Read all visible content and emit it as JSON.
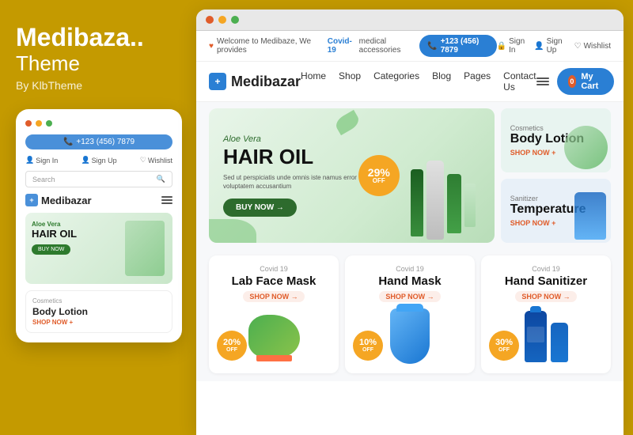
{
  "left": {
    "title": "Medibaza..",
    "subtitle": "Theme",
    "by": "By KlbTheme"
  },
  "mobile": {
    "phone": "+123 (456) 7879",
    "signin": "Sign In",
    "signup": "Sign Up",
    "wishlist": "Wishlist",
    "search_placeholder": "Search",
    "logo": "Medibazar",
    "banner_sub": "Aloe Vera",
    "banner_title": "HAIR OIL",
    "banner_btn": "BUY NOW",
    "product_cat": "Cosmetics",
    "product_name": "Body Lotion",
    "product_shop": "SHOP NOW +"
  },
  "topbar": {
    "welcome": "Welcome to Medibaze, We provides",
    "covid_link": "Covid-19",
    "covid_suffix": "medical accessories",
    "phone": "+123 (456) 7879",
    "signin": "Sign In",
    "signup": "Sign Up",
    "wishlist": "Wishlist"
  },
  "nav": {
    "logo": "Medibazar",
    "links": [
      "Home",
      "Shop",
      "Categories",
      "Blog",
      "Pages",
      "Contact Us"
    ],
    "cart_label": "My Cart",
    "cart_count": "0"
  },
  "hero": {
    "subtitle": "Aloe Vera",
    "title": "HAIR OIL",
    "description": "Sed ut perspiciatis unde omnis iste namus error sit voluptatem accusantium",
    "btn": "BUY NOW →",
    "badge_pct": "29%",
    "badge_off": "OFF"
  },
  "side_cards": [
    {
      "category": "Cosmetics",
      "name": "Body Lotion",
      "shop": "SHOP NOW +"
    },
    {
      "category": "Sanitizer",
      "name": "Temperature",
      "shop": "SHOP NOW +"
    }
  ],
  "products": [
    {
      "covid": "Covid 19",
      "name": "Lab Face Mask",
      "shop": "SHOP NOW →",
      "badge_pct": "20%",
      "badge_off": "OFF"
    },
    {
      "covid": "Covid 19",
      "name": "Hand Mask",
      "shop": "SHOP NOW →",
      "badge_pct": "10%",
      "badge_off": "OFF"
    },
    {
      "covid": "Covid 19",
      "name": "Hand Sanitizer",
      "shop": "SHOP NOW →",
      "badge_pct": "30%",
      "badge_off": "OFF"
    }
  ],
  "colors": {
    "primary": "#2a7fd4",
    "accent": "#f5a623",
    "danger": "#e05c2a",
    "green": "#2d6b2d"
  }
}
